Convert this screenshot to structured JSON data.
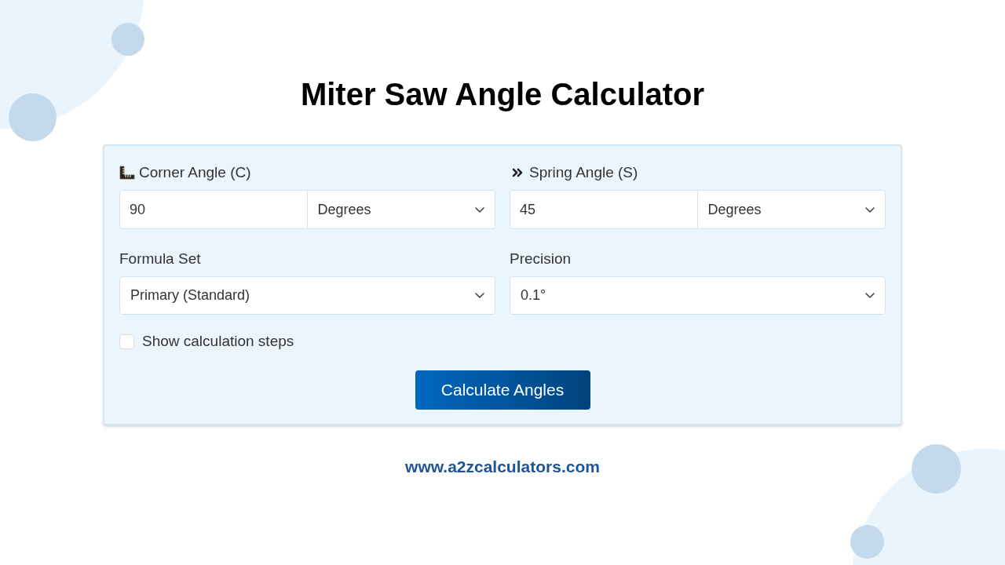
{
  "title": "Miter Saw Angle Calculator",
  "angle_fields": [
    {
      "label": "Corner Angle (C)",
      "value": "90",
      "unit": "Degrees"
    },
    {
      "label": "Spring Angle (S)",
      "value": "45",
      "unit": "Degrees"
    }
  ],
  "select_fields": [
    {
      "label": "Formula Set",
      "value": "Primary (Standard)"
    },
    {
      "label": "Precision",
      "value": "0.1°"
    }
  ],
  "checkbox": {
    "label": "Show calculation steps",
    "checked": false
  },
  "button": "Calculate Angles",
  "footer": "www.a2zcalculators.com"
}
